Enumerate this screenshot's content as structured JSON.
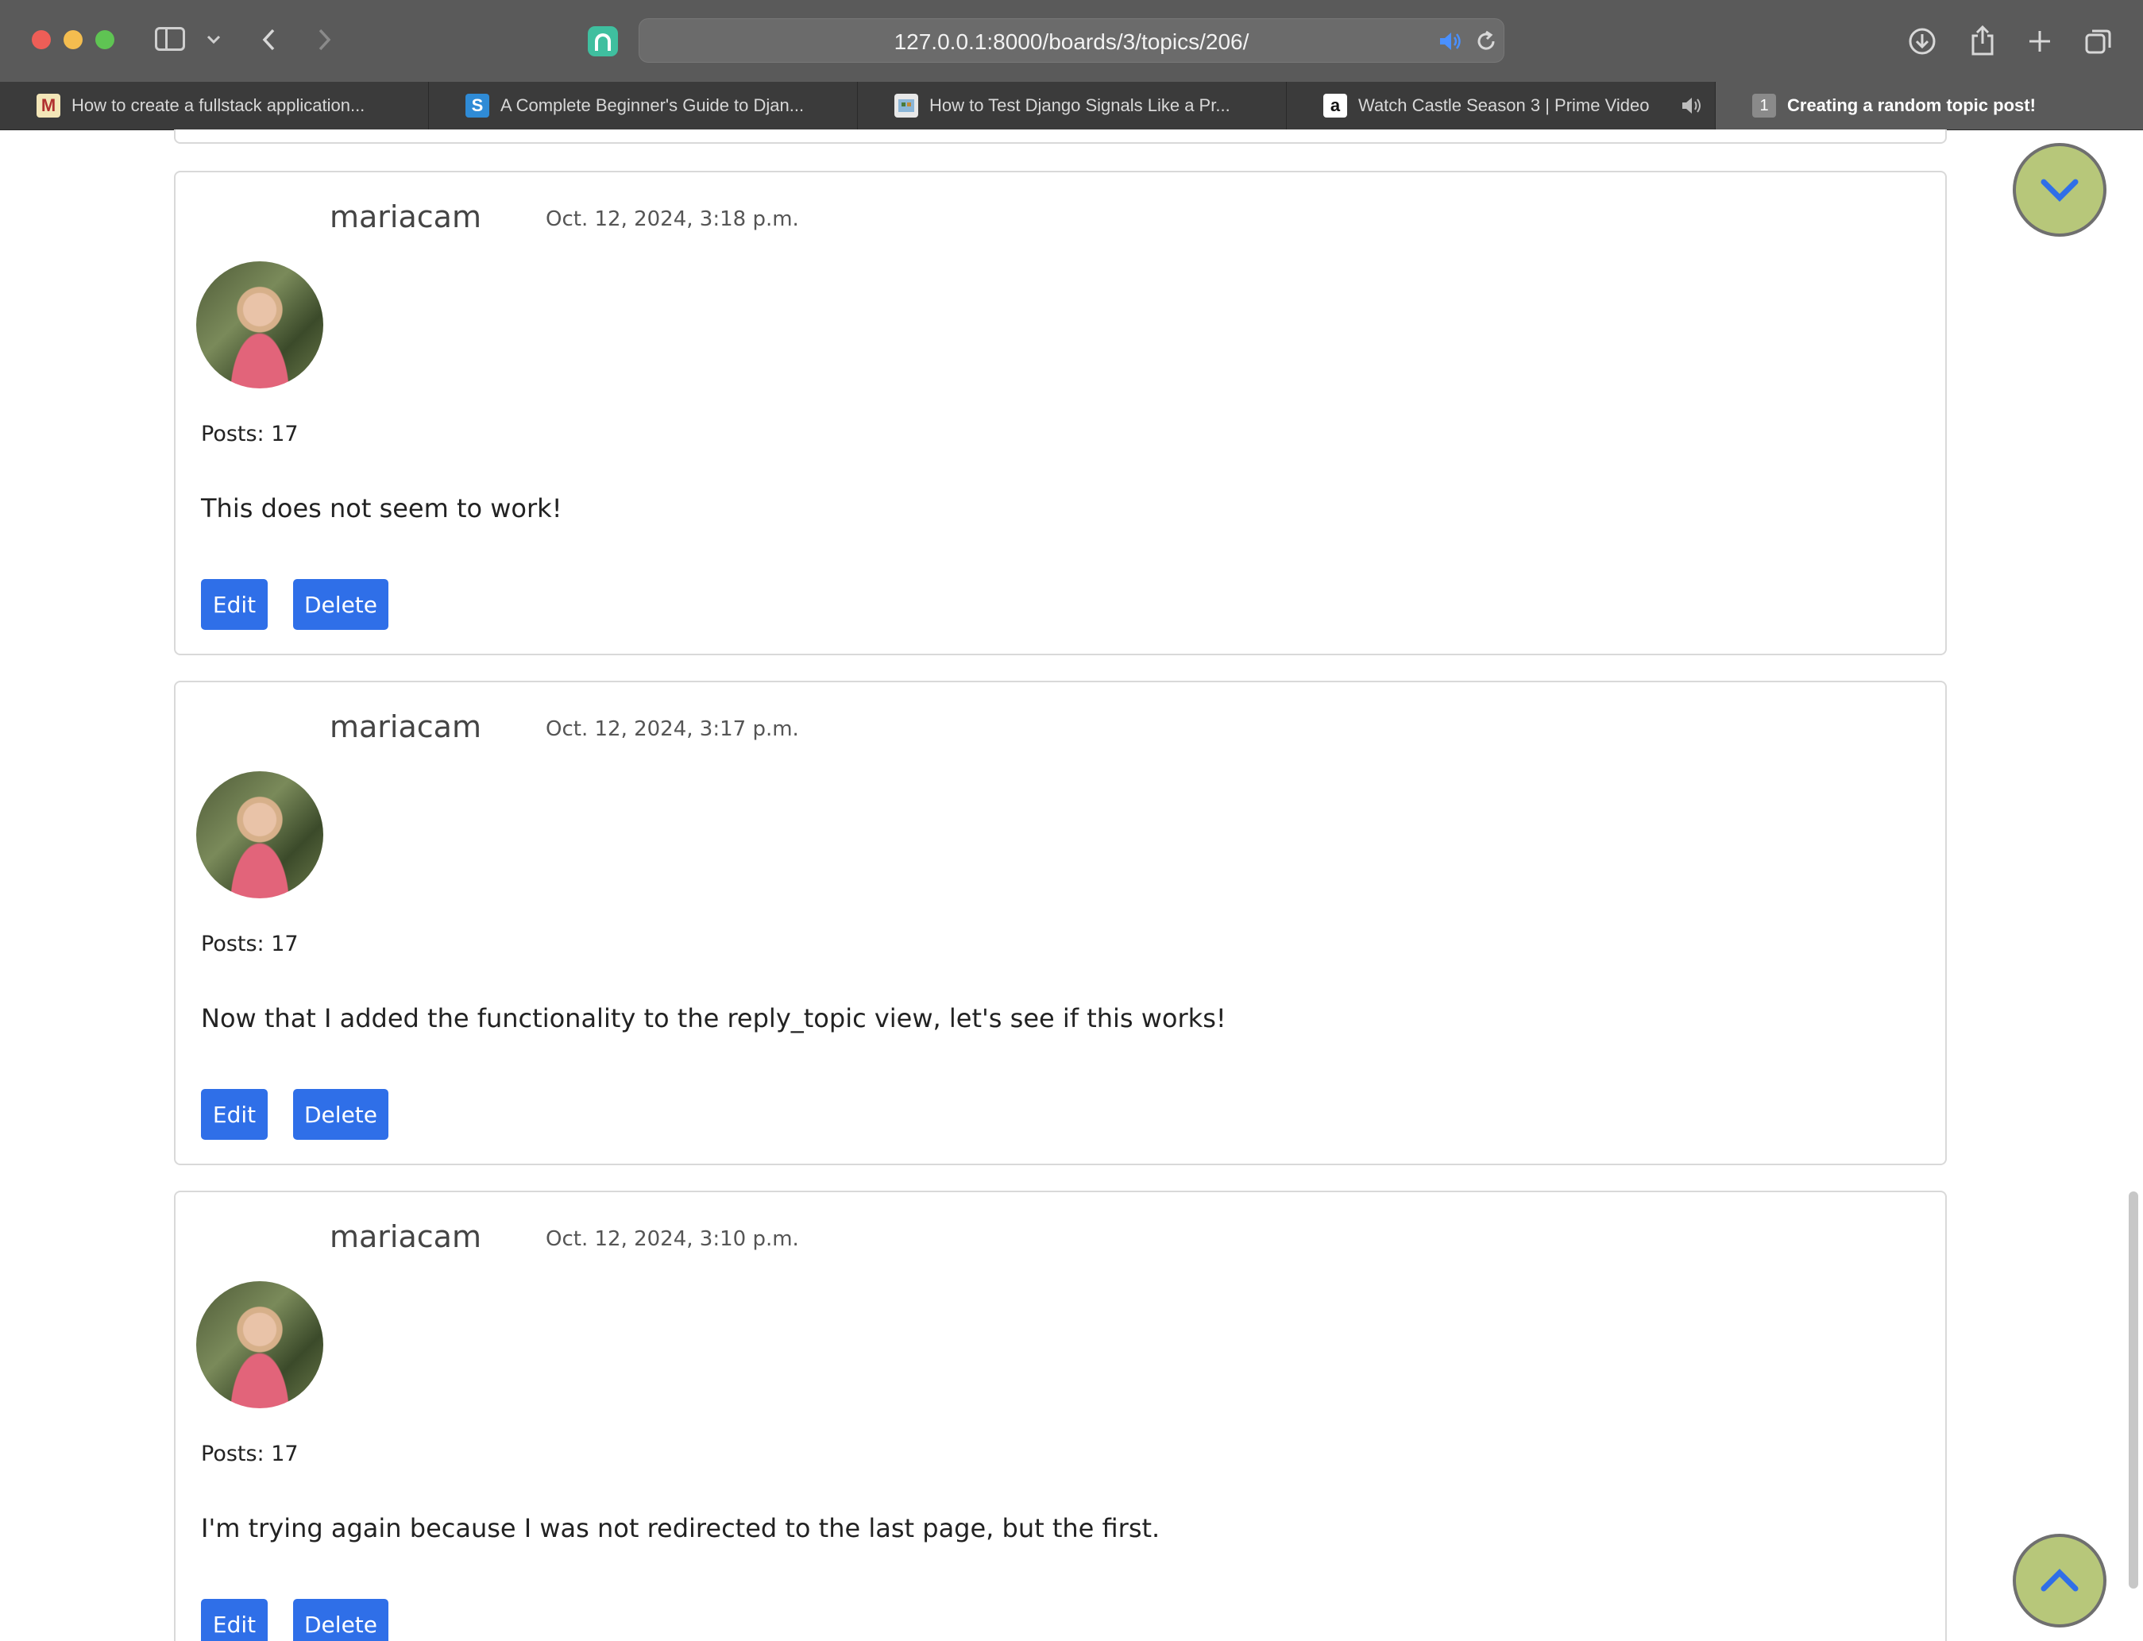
{
  "browser": {
    "url": "127.0.0.1:8000/boards/3/topics/206/",
    "tabs": [
      {
        "label": "How to create a fullstack application...",
        "favicon": "medium-icon"
      },
      {
        "label": "A Complete Beginner's Guide to Djan...",
        "favicon": "s-icon"
      },
      {
        "label": "How to Test Django Signals Like a Pr...",
        "favicon": "site-icon"
      },
      {
        "label": "Watch Castle Season 3 | Prime Video",
        "favicon": "amazon-icon"
      },
      {
        "label": "Creating a random topic post!",
        "favicon": "counter-badge",
        "badge": "1"
      }
    ]
  },
  "posts": [
    {
      "username": "mariacam",
      "date": "Oct. 12, 2024, 3:18 p.m.",
      "posts_count": "Posts: 17",
      "message": "This does not seem to work!",
      "edit_label": "Edit",
      "delete_label": "Delete"
    },
    {
      "username": "mariacam",
      "date": "Oct. 12, 2024, 3:17 p.m.",
      "posts_count": "Posts: 17",
      "message": "Now that I added the functionality to the reply_topic view, let's see if this works!",
      "edit_label": "Edit",
      "delete_label": "Delete"
    },
    {
      "username": "mariacam",
      "date": "Oct. 12, 2024, 3:10 p.m.",
      "posts_count": "Posts: 17",
      "message": "I'm trying again because I was not redirected to the last page, but the first.",
      "edit_label": "Edit",
      "delete_label": "Delete"
    }
  ],
  "colors": {
    "button": "#2f6fe8",
    "scroll_button": "#b7c77a"
  }
}
